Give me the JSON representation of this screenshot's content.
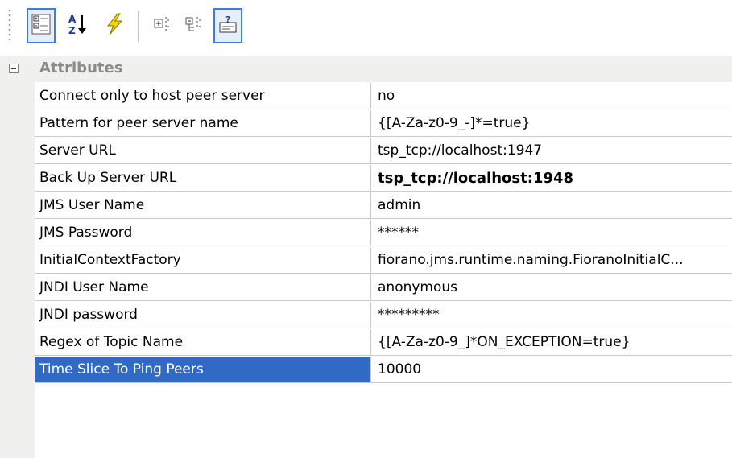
{
  "toolbar": {
    "buttons": [
      {
        "name": "categorized-view-button",
        "icon": "categorized-icon"
      },
      {
        "name": "sort-alphabetical-button",
        "icon": "sort-az-icon"
      },
      {
        "name": "events-button",
        "icon": "lightning-icon"
      },
      {
        "name": "expand-all-button",
        "icon": "expand-icon"
      },
      {
        "name": "collapse-all-button",
        "icon": "collapse-icon"
      },
      {
        "name": "description-toggle-button",
        "icon": "help-panel-icon"
      }
    ]
  },
  "category": {
    "label": "Attributes",
    "expanded": true
  },
  "properties": [
    {
      "name": "Connect only to host peer server",
      "value": "no"
    },
    {
      "name": "Pattern for peer server name",
      "value": "{[A-Za-z0-9_-]*=true}"
    },
    {
      "name": "Server URL",
      "value": "tsp_tcp://localhost:1947"
    },
    {
      "name": "Back Up Server URL",
      "value": "tsp_tcp://localhost:1948",
      "bold": true
    },
    {
      "name": "JMS User Name",
      "value": "admin"
    },
    {
      "name": "JMS Password",
      "value": "******"
    },
    {
      "name": "InitialContextFactory",
      "value": "fiorano.jms.runtime.naming.FioranoInitialC..."
    },
    {
      "name": "JNDI User Name",
      "value": "anonymous"
    },
    {
      "name": "JNDI password",
      "value": "*********"
    },
    {
      "name": "Regex of Topic Name",
      "value": "{[A-Za-z0-9_]*ON_EXCEPTION=true}"
    },
    {
      "name": "Time Slice To Ping Peers",
      "value": "10000",
      "selected": true
    }
  ],
  "colors": {
    "selection": "#316ac5",
    "gutter": "#f0f0ee",
    "gridline": "#c9c9c9"
  }
}
